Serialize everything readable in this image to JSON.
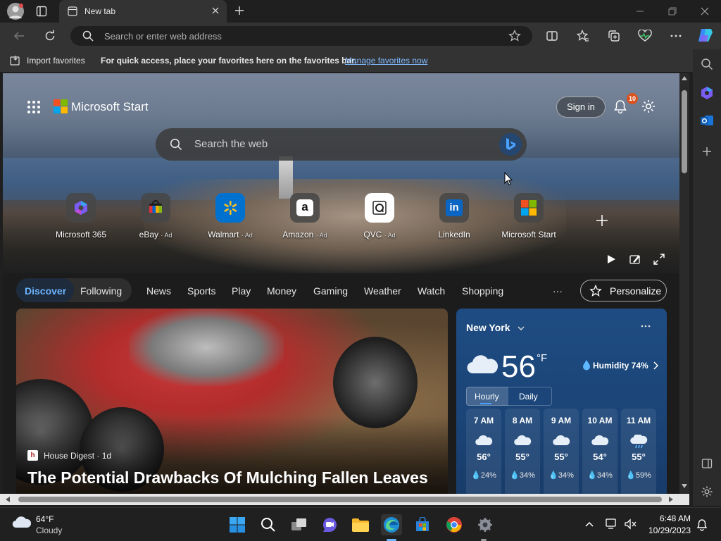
{
  "browser": {
    "tab_title": "New tab",
    "address_placeholder": "Search or enter web address"
  },
  "favorites_bar": {
    "import_label": "Import favorites",
    "hint": "For quick access, place your favorites here on the favorites bar.",
    "manage_link": "Manage favorites now"
  },
  "start": {
    "brand": "Microsoft Start",
    "sign_in": "Sign in",
    "notification_count": "10",
    "search_placeholder": "Search the web",
    "quick_links": [
      {
        "label": "Microsoft 365",
        "ad": "",
        "icon": "microsoft-365-icon"
      },
      {
        "label": "eBay",
        "ad": "· Ad",
        "icon": "ebay-icon"
      },
      {
        "label": "Walmart",
        "ad": "· Ad",
        "icon": "walmart-icon"
      },
      {
        "label": "Amazon",
        "ad": "· Ad",
        "icon": "amazon-icon"
      },
      {
        "label": "QVC",
        "ad": "· Ad",
        "icon": "qvc-icon"
      },
      {
        "label": "LinkedIn",
        "ad": "",
        "icon": "linkedin-icon"
      },
      {
        "label": "Microsoft Start",
        "ad": "",
        "icon": "microsoft-start-icon"
      }
    ]
  },
  "nav": {
    "tabs": [
      "Discover",
      "Following",
      "News",
      "Sports",
      "Play",
      "Money",
      "Gaming",
      "Weather",
      "Watch",
      "Shopping"
    ],
    "more": "···",
    "personalize": "Personalize"
  },
  "story": {
    "source": "House Digest · 1d",
    "source_logo": "h",
    "headline": "The Potential Drawbacks Of Mulching Fallen Leaves"
  },
  "weather": {
    "location": "New York",
    "temp": "56",
    "unit": "°F",
    "humidity": "Humidity 74%",
    "tabs": [
      "Hourly",
      "Daily"
    ],
    "hours": [
      {
        "time": "7 AM",
        "temp": "56°",
        "precip": "24%"
      },
      {
        "time": "8 AM",
        "temp": "55°",
        "precip": "34%"
      },
      {
        "time": "9 AM",
        "temp": "55°",
        "precip": "34%"
      },
      {
        "time": "10 AM",
        "temp": "54°",
        "precip": "34%"
      },
      {
        "time": "11 AM",
        "temp": "55°",
        "precip": "59%"
      }
    ]
  },
  "taskbar": {
    "weather_temp": "64°F",
    "weather_desc": "Cloudy",
    "time": "6:48 AM",
    "date": "10/29/2023"
  },
  "colors": {
    "accent_blue": "#4aa0ff",
    "link": "#7fb8ff",
    "weather_bg": "#1e4c82"
  }
}
